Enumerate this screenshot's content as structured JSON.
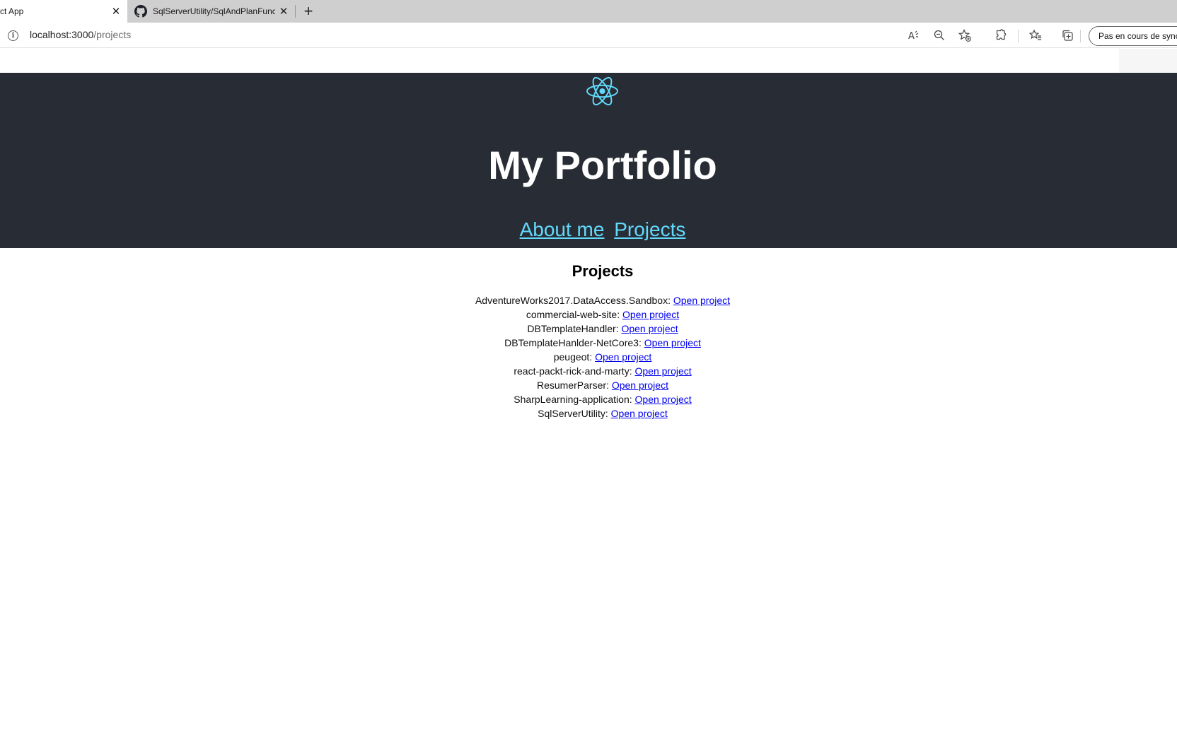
{
  "browser": {
    "tabs": [
      {
        "label": "ct App",
        "active": true
      },
      {
        "label": "SqlServerUtility/SqlAndPlanFunc",
        "active": false
      }
    ],
    "tab_close_glyph": "✕",
    "new_tab_glyph": "+",
    "url_host": "localhost:3000",
    "url_path": "/projects",
    "profile_button": "Pas en cours de synchro"
  },
  "header": {
    "title": "My Portfolio",
    "nav": [
      {
        "label": "About me"
      },
      {
        "label": "Projects"
      }
    ],
    "accent_color": "#61dafb",
    "background_color": "#282c34"
  },
  "main": {
    "heading": "Projects",
    "link_label": "Open project",
    "projects": [
      {
        "name": "AdventureWorks2017.DataAccess.Sandbox:",
        "link": "Open project"
      },
      {
        "name": "commercial-web-site:",
        "link": "Open project"
      },
      {
        "name": "DBTemplateHandler:",
        "link": "Open project"
      },
      {
        "name": "DBTemplateHanlder-NetCore3:",
        "link": "Open project"
      },
      {
        "name": "peugeot:",
        "link": "Open project"
      },
      {
        "name": "react-packt-rick-and-marty:",
        "link": "Open project"
      },
      {
        "name": "ResumerParser:",
        "link": "Open project"
      },
      {
        "name": "SharpLearning-application:",
        "link": "Open project"
      },
      {
        "name": "SqlServerUtility:",
        "link": "Open project"
      }
    ]
  }
}
